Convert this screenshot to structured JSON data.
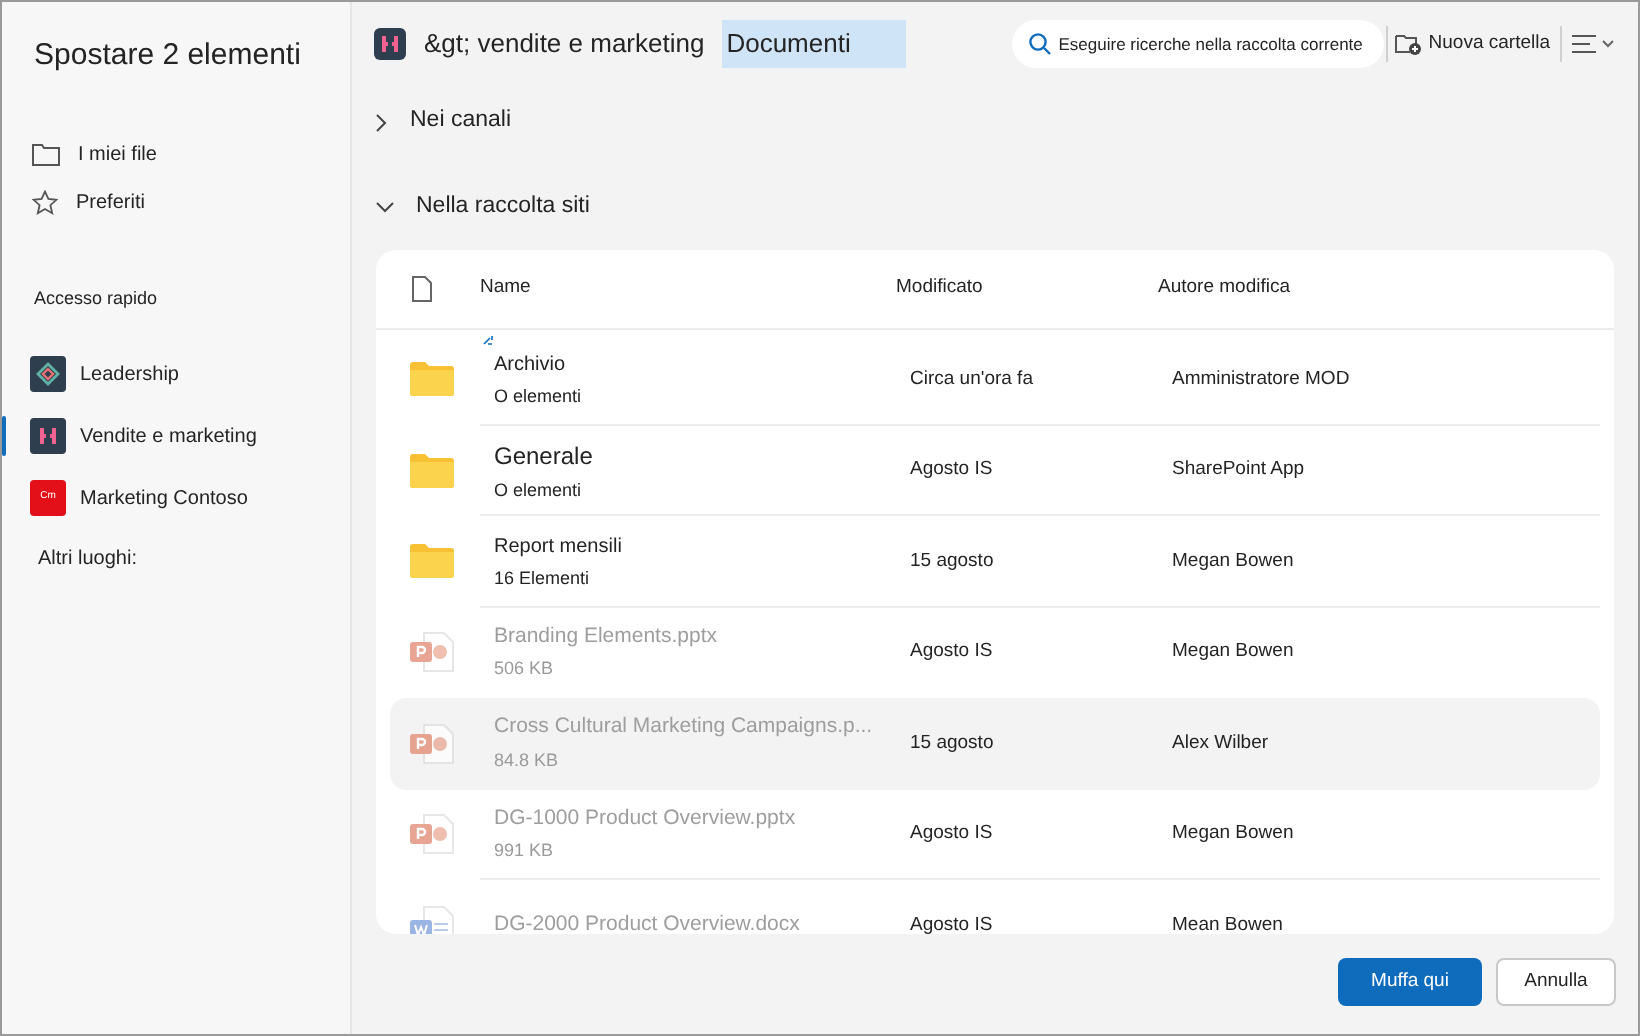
{
  "title": "Spostare 2 elementi",
  "nav": [
    {
      "kind": "folder",
      "label": "I miei file"
    },
    {
      "kind": "star",
      "label": "Preferiti"
    }
  ],
  "quick_access": {
    "heading": "Accesso rapido",
    "sites": [
      {
        "kind": "diamond",
        "label": "Leadership",
        "color": "#2f3e4e",
        "selected": false
      },
      {
        "kind": "figure",
        "label": "Vendite e marketing",
        "color": "#2f3e4e",
        "selected": true
      },
      {
        "kind": "text",
        "label": "Marketing Contoso",
        "color": "#e3101a",
        "icon_text": "Cm",
        "selected": false
      }
    ]
  },
  "other_places": "Altri luoghi:",
  "breadcrumb": {
    "site": "&gt; vendite e marketing",
    "current": "Documenti"
  },
  "search": {
    "placeholder": "Eseguire ricerche nella raccolta corrente"
  },
  "new_folder": "Nuova cartella",
  "sections": [
    {
      "label": "Nei canali",
      "expanded": false
    },
    {
      "label": "Nella raccolta siti",
      "expanded": true
    }
  ],
  "table": {
    "columns": [
      "Name",
      "Modificato",
      "Autore modifica"
    ],
    "rows": [
      {
        "kind": "folder",
        "name": "Archivio",
        "detail": "O elementi",
        "modified": "Circa un'ora fa",
        "author": "Amministratore MOD",
        "disabled": false,
        "highlighted": false,
        "loading": true
      },
      {
        "kind": "folder",
        "name": "Generale",
        "detail": "O elementi",
        "modified": "Agosto IS",
        "author": "SharePoint App",
        "disabled": false,
        "highlighted": false,
        "loading": false
      },
      {
        "kind": "folder",
        "name": "Report mensili",
        "detail": "16 Elementi",
        "modified": "15 agosto",
        "author": "Megan Bowen",
        "disabled": false,
        "highlighted": false,
        "loading": false
      },
      {
        "kind": "pptx",
        "name": "Branding Elements.pptx",
        "detail": "506 KB",
        "modified": "Agosto IS",
        "author": "Megan Bowen",
        "disabled": true,
        "highlighted": false,
        "loading": false
      },
      {
        "kind": "pptx",
        "name": "Cross Cultural Marketing Campaigns.p...",
        "detail": "84.8 KB",
        "modified": "15 agosto",
        "author": "Alex Wilber",
        "disabled": true,
        "highlighted": true,
        "loading": false
      },
      {
        "kind": "pptx",
        "name": "DG-1000 Product Overview.pptx",
        "detail": "991 KB",
        "modified": "Agosto IS",
        "author": "Megan Bowen",
        "disabled": true,
        "highlighted": false,
        "loading": false
      },
      {
        "kind": "docx",
        "name": "DG-2000 Product Overview.docx",
        "modified": "Agosto IS",
        "author": "Mean Bowen",
        "disabled": true,
        "highlighted": false,
        "loading": false
      }
    ]
  },
  "buttons": [
    {
      "kind": "primary",
      "label": "Muffa qui"
    },
    {
      "kind": "secondary",
      "label": "Annulla"
    }
  ]
}
